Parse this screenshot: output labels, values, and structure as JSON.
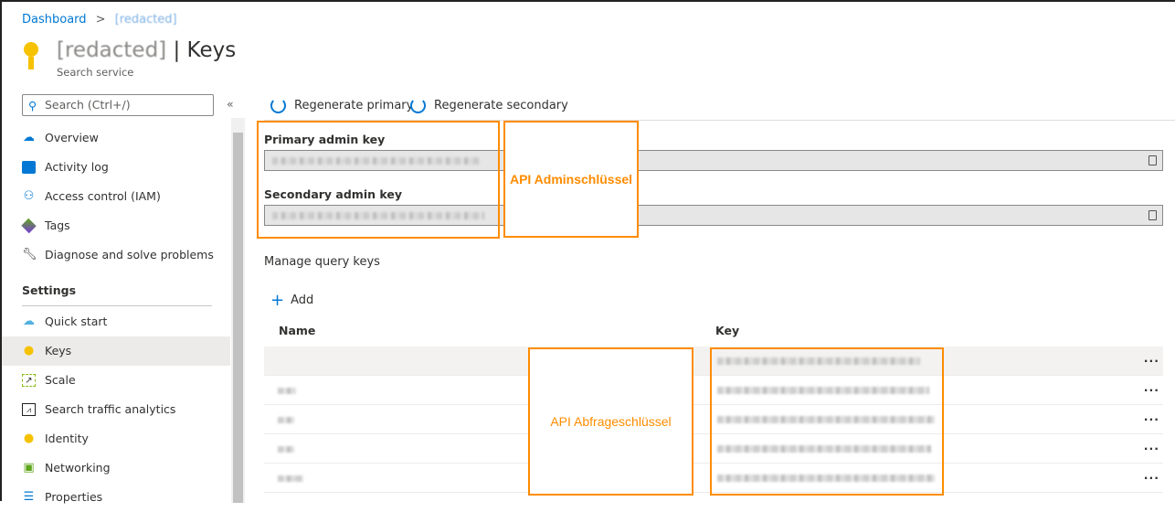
{
  "breadcrumb": {
    "home": "Dashboard",
    "current": "[redacted]"
  },
  "header": {
    "resource_name": "[redacted]",
    "page": "| Keys",
    "subtitle": "Search service"
  },
  "sidebar": {
    "search_placeholder": "Search (Ctrl+/)",
    "collapse": "«",
    "items": [
      {
        "label": "Overview",
        "icon": "cloud-search-icon"
      },
      {
        "label": "Activity log",
        "icon": "log-icon"
      },
      {
        "label": "Access control (IAM)",
        "icon": "people-icon"
      },
      {
        "label": "Tags",
        "icon": "tag-icon"
      },
      {
        "label": "Diagnose and solve problems",
        "icon": "wrench-icon"
      }
    ],
    "section": "Settings",
    "settings_items": [
      {
        "label": "Quick start",
        "icon": "cloud-bolt-icon"
      },
      {
        "label": "Keys",
        "icon": "key-icon",
        "selected": true
      },
      {
        "label": "Scale",
        "icon": "scale-icon"
      },
      {
        "label": "Search traffic analytics",
        "icon": "analytics-icon"
      },
      {
        "label": "Identity",
        "icon": "identity-key-icon"
      },
      {
        "label": "Networking",
        "icon": "network-lock-icon"
      },
      {
        "label": "Properties",
        "icon": "sliders-icon"
      }
    ]
  },
  "toolbar": {
    "regen_primary": "Regenerate primary",
    "regen_secondary": "Regenerate secondary"
  },
  "admin": {
    "primary_label": "Primary admin key",
    "secondary_label": "Secondary admin key"
  },
  "query": {
    "title": "Manage query keys",
    "add": "Add",
    "col_name": "Name",
    "col_key": "Key",
    "more": "···"
  },
  "annotations": {
    "admin": "API Adminschlüssel",
    "query": "API Abfrageschlüssel"
  },
  "colors": {
    "accent": "#0078d4",
    "annotation": "#ff8c00"
  }
}
